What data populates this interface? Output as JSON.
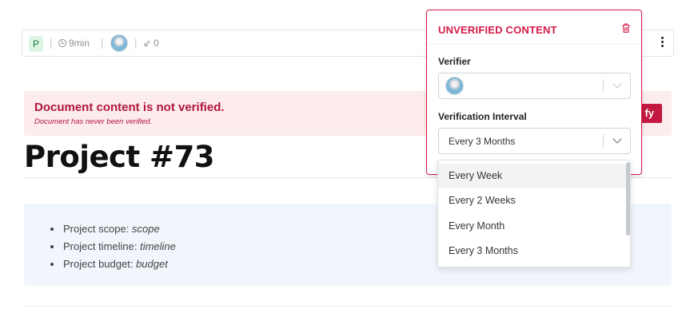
{
  "toolbar": {
    "author_initial": "P",
    "read_time": "9min",
    "backlinks": "0"
  },
  "banner": {
    "title": "Document content is not verified.",
    "subtitle": "Document has never been verified.",
    "verify_label": "fy"
  },
  "page": {
    "title": "Project #73",
    "items": [
      {
        "label": "Project scope: ",
        "value": "scope"
      },
      {
        "label": "Project timeline: ",
        "value": "timeline"
      },
      {
        "label": "Project budget: ",
        "value": "budget"
      }
    ]
  },
  "popover": {
    "title": "UNVERIFIED CONTENT",
    "verifier_label": "Verifier",
    "interval_label": "Verification Interval",
    "interval_value": "Every 3 Months",
    "options": [
      "Every Week",
      "Every 2 Weeks",
      "Every Month",
      "Every 3 Months"
    ]
  },
  "colors": {
    "accent": "#d31a45",
    "banner_bg": "#fdecee",
    "info_bg": "#f1f6fc"
  }
}
